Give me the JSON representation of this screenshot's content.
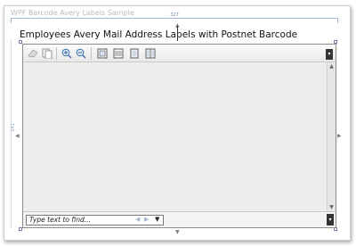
{
  "window": {
    "title": "WPF Barcode Avery Labels Sample"
  },
  "designer": {
    "top_ruler_label": "327",
    "left_ruler_label": "241"
  },
  "heading": {
    "text": "Employees Avery Mail Address Labels with Postnet Barcode"
  },
  "toolbar": {
    "buttons": [
      {
        "name": "print",
        "icon": "print-icon"
      },
      {
        "name": "copy",
        "icon": "copy-icon"
      },
      {
        "name": "zoom-in",
        "icon": "zoom-in-icon"
      },
      {
        "name": "zoom-out",
        "icon": "zoom-out-icon"
      },
      {
        "name": "actual-size",
        "icon": "actual-size-icon"
      },
      {
        "name": "page-width",
        "icon": "page-width-icon"
      },
      {
        "name": "whole-page",
        "icon": "whole-page-icon"
      },
      {
        "name": "two-pages",
        "icon": "two-pages-icon"
      }
    ]
  },
  "find": {
    "placeholder": "Type text to find..."
  },
  "colors": {
    "adorner": "#6f86aa",
    "accent": "#2f74c9"
  }
}
